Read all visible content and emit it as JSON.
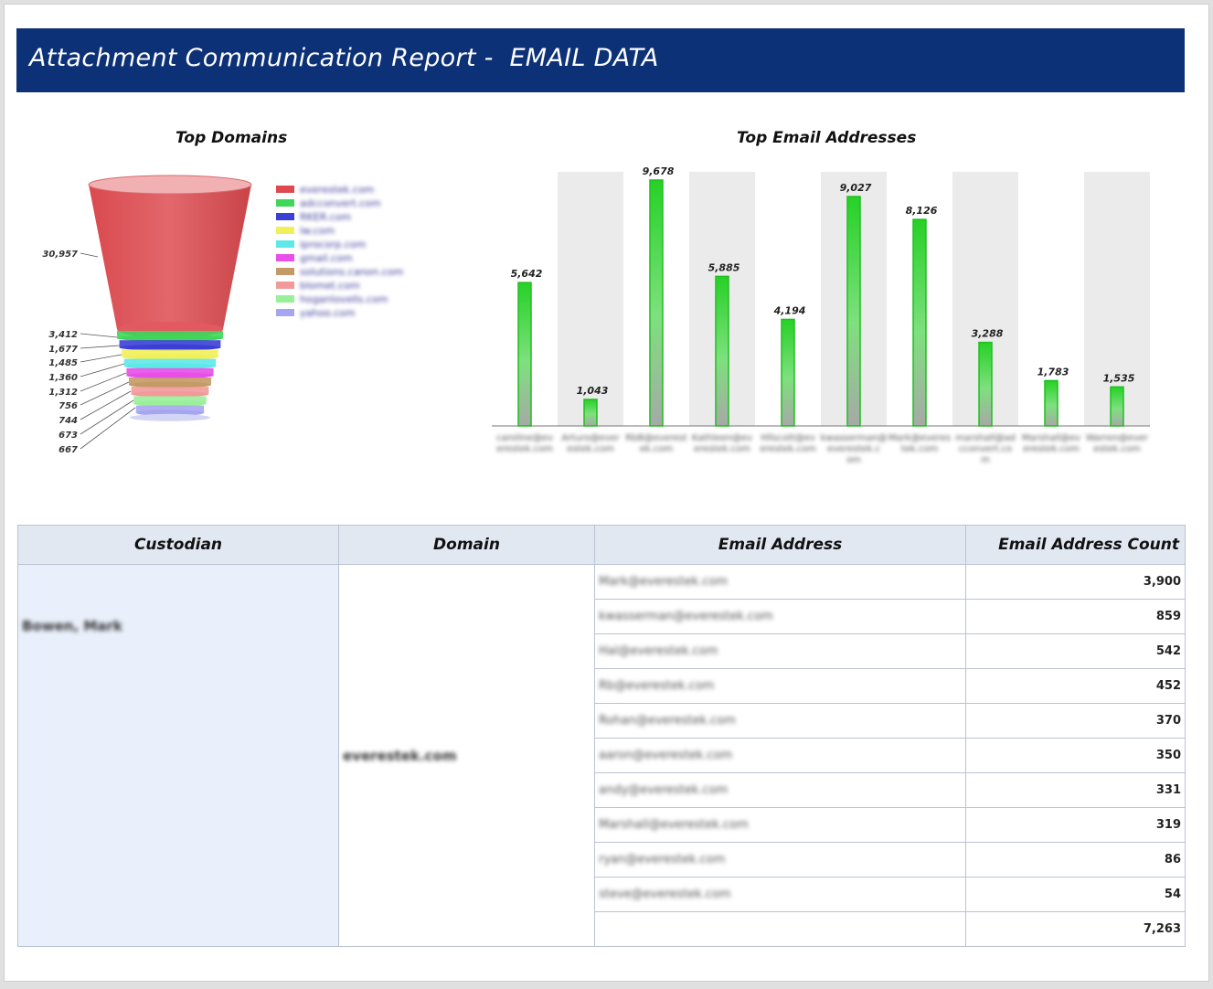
{
  "header": {
    "title": "Attachment Communication Report -  EMAIL DATA"
  },
  "charts": {
    "left_title": "Top Domains",
    "right_title": "Top Email Addresses"
  },
  "colors": {
    "header_bg": "#0d3177",
    "bar_green": "#2ecc2e",
    "table_header_bg": "#e2e8f2"
  },
  "chart_data": [
    {
      "type": "funnel",
      "title": "Top Domains",
      "values": [
        30957,
        3412,
        1677,
        1485,
        1360,
        1312,
        756,
        744,
        673,
        667
      ],
      "value_labels": [
        "30,957",
        "3,412",
        "1,677",
        "1,485",
        "1,360",
        "1,312",
        "756",
        "744",
        "673",
        "667"
      ],
      "legend_placement": "right",
      "legend": [
        {
          "name": "everestek.com",
          "color": "#e0484f"
        },
        {
          "name": "adcconvert.com",
          "color": "#3fd65a"
        },
        {
          "name": "RKER.com",
          "color": "#3b3fd6"
        },
        {
          "name": "lw.com",
          "color": "#f2f05a"
        },
        {
          "name": "iprocorp.com",
          "color": "#5ee8e8"
        },
        {
          "name": "gmail.com",
          "color": "#e84ee8"
        },
        {
          "name": "solutions.canon.com",
          "color": "#c49a66"
        },
        {
          "name": "blomet.com",
          "color": "#f29a9a"
        },
        {
          "name": "hoganlovells.com",
          "color": "#9af09a"
        },
        {
          "name": "yahoo.com",
          "color": "#a6a6f0"
        }
      ]
    },
    {
      "type": "bar",
      "title": "Top Email Addresses",
      "categories": [
        "caroline@everestek.com",
        "Arturo@everestek.com",
        "RbB@everestek.com",
        "Kathleen@everestek.com",
        "Hllscott@everestek.com",
        "kwasserman@everestek.com",
        "Mark@everestek.com",
        "marshall@adcconvert.com",
        "Marshall@everestek.com",
        "Warren@everestek.com"
      ],
      "values": [
        5642,
        1043,
        9678,
        5885,
        4194,
        9027,
        8126,
        3288,
        1783,
        1535
      ],
      "value_labels": [
        "5,642",
        "1,043",
        "9,678",
        "5,885",
        "4,194",
        "9,027",
        "8,126",
        "3,288",
        "1,783",
        "1,535"
      ],
      "ylim": [
        0,
        10000
      ]
    }
  ],
  "table": {
    "headers": [
      "Custodian",
      "Domain",
      "Email Address",
      "Email Address Count"
    ],
    "custodian": "Bowen, Mark",
    "domain": "everestek.com",
    "rows": [
      {
        "email": "Mark@everestek.com",
        "count": "3,900"
      },
      {
        "email": "kwasserman@everestek.com",
        "count": "859"
      },
      {
        "email": "Hal@everestek.com",
        "count": "542"
      },
      {
        "email": "Rb@everestek.com",
        "count": "452"
      },
      {
        "email": "Rohan@everestek.com",
        "count": "370"
      },
      {
        "email": "aaron@everestek.com",
        "count": "350"
      },
      {
        "email": "andy@everestek.com",
        "count": "331"
      },
      {
        "email": "Marshall@everestek.com",
        "count": "319"
      },
      {
        "email": "ryan@everestek.com",
        "count": "86"
      },
      {
        "email": "steve@everestek.com",
        "count": "54"
      }
    ],
    "total": "7,263"
  }
}
